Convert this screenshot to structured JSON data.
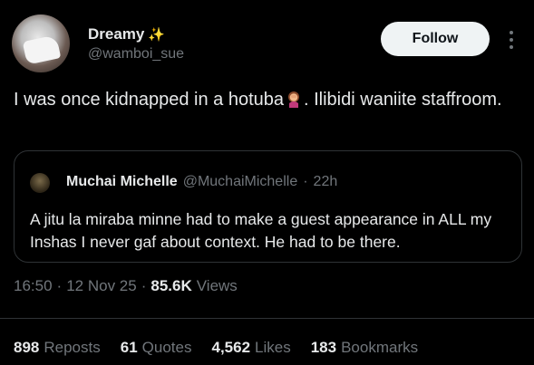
{
  "author": {
    "name": "Dreamy",
    "name_emoji": "sparkles-icon",
    "handle": "@wamboi_sue"
  },
  "follow_label": "Follow",
  "tweet": {
    "text_before": "I was once kidnapped in a hotuba",
    "emoji": "woman-facepalming-emoji",
    "text_after": ". Ilibidi waniite staffroom."
  },
  "quote": {
    "name": "Muchai Michelle",
    "handle": "@MuchaiMichelle",
    "separator": "·",
    "time": "22h",
    "text": "A jitu la miraba minne had to make a guest appearance in ALL my Inshas I never gaf about context. He had to be there."
  },
  "meta": {
    "time": "16:50",
    "sep1": "·",
    "date": "12 Nov 25",
    "sep2": "·",
    "views_count": "85.6K",
    "views_label": "Views"
  },
  "stats": [
    {
      "count": "898",
      "label": "Reposts"
    },
    {
      "count": "61",
      "label": "Quotes"
    },
    {
      "count": "4,562",
      "label": "Likes"
    },
    {
      "count": "183",
      "label": "Bookmarks"
    }
  ],
  "colors": {
    "background": "#000000",
    "text": "#e7e9ea",
    "secondary": "#71767b",
    "border": "#2f3336",
    "follow_bg": "#eff3f4"
  }
}
